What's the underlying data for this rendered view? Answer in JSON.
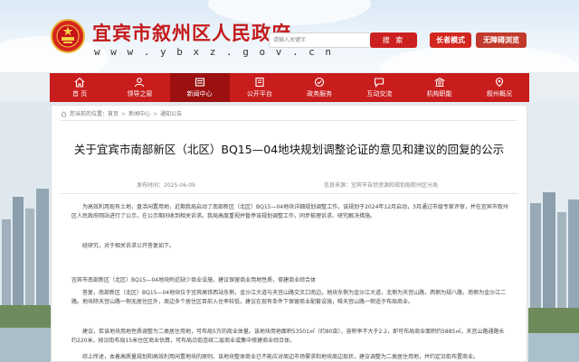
{
  "site": {
    "title": "宜宾市叙州区人民政府",
    "url": "w w w . y b x z . g o v . c n"
  },
  "search": {
    "placeholder": "请输入关键字",
    "button_label": "搜  索"
  },
  "modes": {
    "elder": "长者模式",
    "accessible": "无障碍浏览"
  },
  "nav": {
    "items": [
      {
        "label": "首 页",
        "icon": "home-icon"
      },
      {
        "label": "领导之窗",
        "icon": "leader-icon"
      },
      {
        "label": "新闻中心",
        "icon": "news-icon"
      },
      {
        "label": "公开平台",
        "icon": "disclosure-icon"
      },
      {
        "label": "政务服务",
        "icon": "service-icon"
      },
      {
        "label": "互动交流",
        "icon": "interaction-icon"
      },
      {
        "label": "机构职能",
        "icon": "organization-icon"
      },
      {
        "label": "叙州概况",
        "icon": "overview-icon"
      }
    ],
    "active_index": 2
  },
  "breadcrumb": {
    "prefix": "您当前的位置：",
    "items": [
      "首页",
      "新闻中心",
      "通知公告"
    ]
  },
  "article": {
    "title": "关于宜宾市南部新区（北区）BQ15—04地块规划调整论证的意见和建议的回复的公示",
    "date": "发布时间：2025-06-09",
    "source": "信息来源：宜宾市自然资源和规划局叙州区分局",
    "p1": "为高效利用现有土地，盘活闲置用地，近期我局启动了南部新区（北区）BQ15—04地块详细规划调整工作。该规划于2024年12月启动，3月通过市级专家评审，并在宜宾市叙州区人民政府网站进行了公示，在公示期间收到相关诉求。我局高度重视并暂停该规划调整工作，同步梳理诉求、研究解决措施。",
    "p2": "经研究，对于相关诉求公开答复如下。",
    "p3": "宜宾市南部新区（北区）BQ15—04地块附近缺少商业设施，建议保留商业用地性质，修建商业综合体",
    "p4": "答复，南部新区（北区）BQ15—04地块位于宜宾高铁西站东侧，金沙江大道与天宫山路交叉口南边，地块东侧为金沙江大道，北侧为天宫山路，西侧为规八路，南侧为金沙江二路。地块除天宫山路一侧无居住区外，周边多个居住区目前入住率较低，建议在现有条件下保留商业配套设施，唯天宫山路一侧适于布局商业。",
    "p5": "建议，若该地块用地性质调整为二类居住用地，可布局5万的商业体量。该地块用地面积53501㎡（约80亩），容积率不大于2.2，即可布局商业面积约5885㎡，天宫山路通路长约220米，按沿街布局15米住区商业估算，可布局沿街连续二层商业或集中修建商业综合体。",
    "p6": "综上所述，本着高质量规划和高效利用闲置地块的原则，该地块整体商业已不能应对周边市场需求和地块周边现状，建议调整为二类居住用地，并约定沿街布置商业。"
  },
  "colors": {
    "brand_red": "#c91d1d",
    "active_nav": "#9c1010"
  }
}
